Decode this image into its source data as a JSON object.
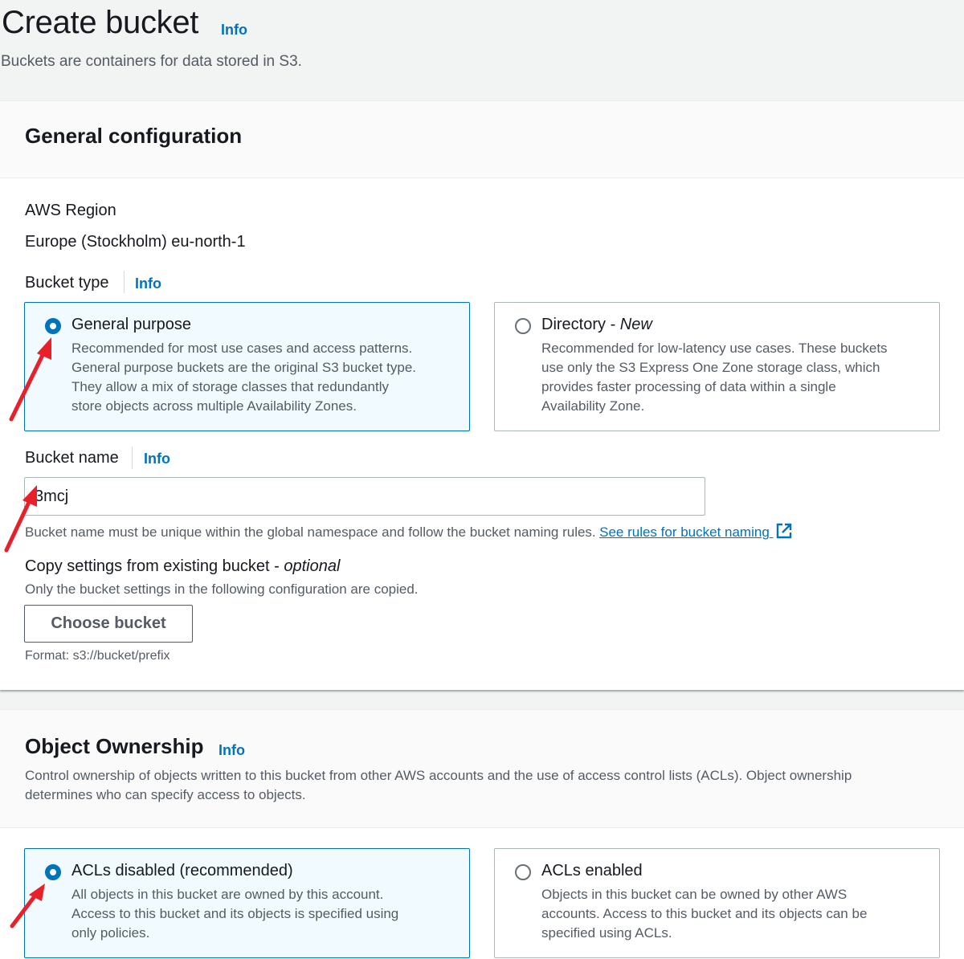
{
  "header": {
    "title": "Create bucket",
    "info": "Info",
    "description": "Buckets are containers for data stored in S3."
  },
  "general": {
    "title": "General configuration",
    "region_label": "AWS Region",
    "region_value": "Europe (Stockholm) eu-north-1",
    "bucket_type_label": "Bucket type",
    "bucket_type_info": "Info",
    "options": [
      {
        "title": "General purpose",
        "title_suffix": "",
        "description": [
          "Recommended for most use cases and access patterns.",
          "General purpose buckets are the original S3 bucket type.",
          "They allow a mix of storage classes that redundantly",
          "store objects across multiple Availability Zones."
        ],
        "selected": true
      },
      {
        "title": "Directory - ",
        "title_suffix": "New",
        "description": [
          "Recommended for low-latency use cases. These buckets",
          "use only the S3 Express One Zone storage class, which",
          "provides faster processing of data within a single",
          "Availability Zone."
        ],
        "selected": false
      }
    ],
    "bucket_name_label": "Bucket name",
    "bucket_name_info": "Info",
    "bucket_name_value": "3mcj",
    "bucket_name_hint": "Bucket name must be unique within the global namespace and follow the bucket naming rules.",
    "bucket_name_link": "See rules for bucket naming",
    "copy_label": "Copy settings from existing bucket - ",
    "copy_optional": "optional",
    "copy_hint": "Only the bucket settings in the following configuration are copied.",
    "choose_button": "Choose bucket",
    "format_hint": "Format: s3://bucket/prefix"
  },
  "ownership": {
    "title": "Object Ownership",
    "info": "Info",
    "description": [
      "Control ownership of objects written to this bucket from other AWS accounts and the use of access control lists (ACLs). Object ownership",
      "determines who can specify access to objects."
    ],
    "options": [
      {
        "title": "ACLs disabled (recommended)",
        "description": [
          "All objects in this bucket are owned by this account.",
          "Access to this bucket and its objects is specified using",
          "only policies."
        ],
        "selected": true
      },
      {
        "title": "ACLs enabled",
        "description": [
          "Objects in this bucket can be owned by other AWS",
          "accounts. Access to this bucket and its objects can be",
          "specified using ACLs."
        ],
        "selected": false
      }
    ]
  },
  "colors": {
    "accent": "#0073bb",
    "annotation_arrow": "#e8202a"
  },
  "icons": [
    "external-link-icon",
    "annotation-arrow-icon"
  ]
}
